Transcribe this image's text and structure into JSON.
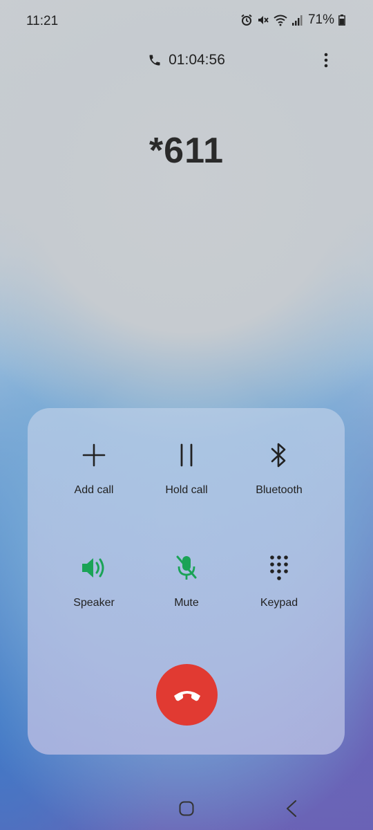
{
  "status_bar": {
    "time": "11:21",
    "battery": "71%"
  },
  "call": {
    "duration": "01:04:56",
    "number": "*611"
  },
  "controls": [
    {
      "label": "Add call",
      "icon": "plus-icon"
    },
    {
      "label": "Hold call",
      "icon": "pause-icon"
    },
    {
      "label": "Bluetooth",
      "icon": "bluetooth-icon"
    },
    {
      "label": "Speaker",
      "icon": "speaker-icon",
      "active": true
    },
    {
      "label": "Mute",
      "icon": "mic-off-icon",
      "active": true
    },
    {
      "label": "Keypad",
      "icon": "keypad-icon"
    }
  ],
  "colors": {
    "active_green": "#1aa356",
    "end_call_red": "#e13a32"
  }
}
